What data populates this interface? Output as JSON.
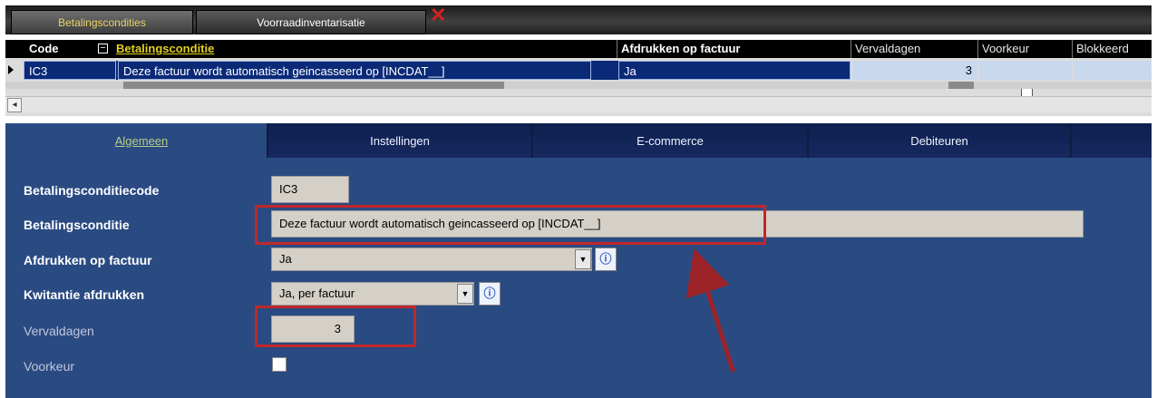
{
  "top_tabs": [
    {
      "label": "Betalingscondities",
      "active": true
    },
    {
      "label": "Voorraadinventarisatie",
      "active": false
    }
  ],
  "grid": {
    "headers": {
      "code": "Code",
      "betalingsconditie": "Betalingsconditie",
      "afdrukken": "Afdrukken op factuur",
      "vervaldagen": "Vervaldagen",
      "voorkeur": "Voorkeur",
      "blokkeerd": "Blokkeerd"
    },
    "collapse_symbol": "−",
    "rows": [
      {
        "code": "IC3",
        "betalingsconditie": "Deze factuur wordt automatisch geincasseerd op  [INCDAT__]",
        "afdrukken": "Ja",
        "vervaldagen": "3",
        "voorkeur": false,
        "selected": true
      }
    ],
    "scroll_left_glyph": "◂"
  },
  "form": {
    "tabs": [
      {
        "label": "Algemeen",
        "active": true
      },
      {
        "label": "Instellingen",
        "active": false
      },
      {
        "label": "E-commerce",
        "active": false
      },
      {
        "label": "Debiteuren",
        "active": false
      }
    ],
    "labels": {
      "code": "Betalingsconditiecode",
      "conditie": "Betalingsconditie",
      "afdrukken": "Afdrukken op factuur",
      "kwitantie": "Kwitantie afdrukken",
      "vervaldagen": "Vervaldagen",
      "voorkeur": "Voorkeur"
    },
    "values": {
      "code": "IC3",
      "conditie": "Deze factuur wordt automatisch geincasseerd op  [INCDAT__]",
      "afdrukken": "Ja",
      "kwitantie": "Ja, per factuur",
      "vervaldagen": "3",
      "voorkeur": false
    },
    "dropdown_glyph": "▼",
    "info_glyph": "ⓘ"
  },
  "colors": {
    "panel_bg": "#2a4a82",
    "highlight_red": "#c0282a",
    "selected_row": "#0a2a78",
    "active_tab_text": "#e9d266"
  }
}
